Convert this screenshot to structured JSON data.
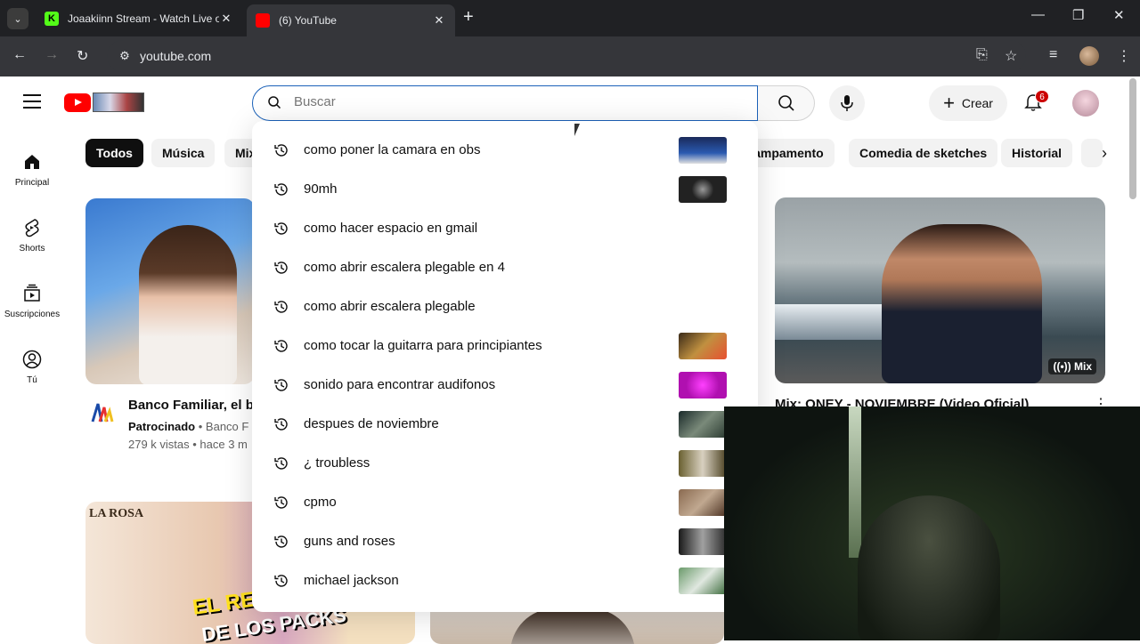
{
  "browser": {
    "tabs": [
      {
        "title": "Joaakiinn Stream - Watch Live o",
        "favicon_color": "#53fc18"
      },
      {
        "title": "(6) YouTube",
        "favicon_color": "#ff0000"
      }
    ],
    "url": "youtube.com"
  },
  "header": {
    "search_placeholder": "Buscar",
    "create_label": "Crear",
    "notification_count": "6"
  },
  "sidebar": {
    "items": [
      {
        "label": "Principal",
        "icon": "home-icon"
      },
      {
        "label": "Shorts",
        "icon": "shorts-icon"
      },
      {
        "label": "Suscripciones",
        "icon": "subscriptions-icon"
      },
      {
        "label": "Tú",
        "icon": "you-icon"
      }
    ]
  },
  "chips": [
    {
      "label": "Todos"
    },
    {
      "label": "Música"
    },
    {
      "label": "Mix"
    },
    {
      "label": "Campamento"
    },
    {
      "label": "Comedia de sketches"
    },
    {
      "label": "Historial"
    }
  ],
  "videos": [
    {
      "title": "Banco Familiar, el b",
      "channel": "Patrocinado",
      "channel_name": "Banco F",
      "meta": "279 k vistas • hace 3 m"
    },
    {
      "title": "Mix: ONEY - NOVIEMBRE (Video Oficial)",
      "badge": "Mix"
    }
  ],
  "suggestions": [
    {
      "text": "como poner la camara en obs",
      "thumb": "#1a3a7a"
    },
    {
      "text": "90mh",
      "thumb": "#222222"
    },
    {
      "text": "como hacer espacio en gmail",
      "thumb": ""
    },
    {
      "text": "como abrir escalera plegable en 4",
      "thumb": ""
    },
    {
      "text": "como abrir escalera plegable",
      "thumb": ""
    },
    {
      "text": "como tocar la guitarra para principiantes",
      "thumb": "#7a5a20"
    },
    {
      "text": "sonido para encontrar audifonos",
      "thumb": "#d020d0"
    },
    {
      "text": "despues de noviembre",
      "thumb": "#3a4a3a"
    },
    {
      "text": "¿ troubless",
      "thumb": "#5a5030"
    },
    {
      "text": "cpmo",
      "thumb": "#6a5040"
    },
    {
      "text": "guns and roses",
      "thumb": "#3a3a3a"
    },
    {
      "text": "michael jackson",
      "thumb": "#4a7a4a"
    }
  ],
  "colors": {
    "accent": "#ff0000",
    "focus_border": "#1c62b9"
  }
}
